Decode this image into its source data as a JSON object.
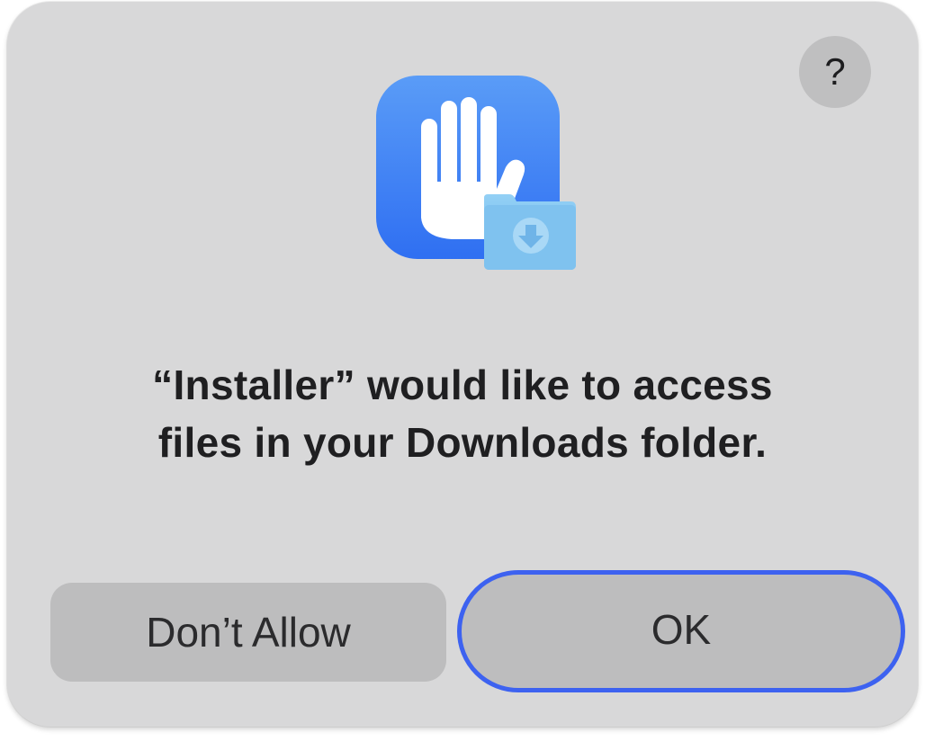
{
  "dialog": {
    "help_label": "?",
    "icon": "privacy-hand-downloads-folder-icon",
    "message_line1": "“Installer” would like to access",
    "message_line2": "files in your Downloads folder.",
    "deny_label": "Don’t Allow",
    "ok_label": "OK"
  },
  "colors": {
    "dialog_bg": "#d8d8d9",
    "button_bg": "#bdbdbe",
    "focus_ring": "#3d62f0",
    "icon_blue": "#3478f6",
    "folder_blue": "#7dc2f0"
  }
}
